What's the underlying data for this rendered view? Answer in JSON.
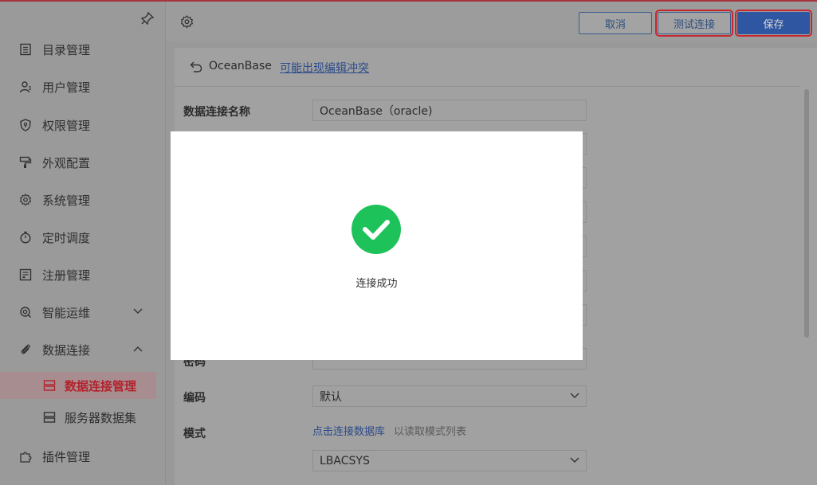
{
  "sidebar": {
    "items": [
      {
        "label": "目录管理",
        "icon": "list-icon"
      },
      {
        "label": "用户管理",
        "icon": "user-icon"
      },
      {
        "label": "权限管理",
        "icon": "shield-icon"
      },
      {
        "label": "外观配置",
        "icon": "paint-roller-icon"
      },
      {
        "label": "系统管理",
        "icon": "gear-icon"
      },
      {
        "label": "定时调度",
        "icon": "stopwatch-icon"
      },
      {
        "label": "注册管理",
        "icon": "register-icon"
      },
      {
        "label": "智能运维",
        "icon": "ops-icon"
      },
      {
        "label": "数据连接",
        "icon": "paperclip-icon"
      },
      {
        "label": "插件管理",
        "icon": "puzzle-icon"
      }
    ],
    "sub_items": [
      {
        "label": "数据连接管理",
        "icon": "server-icon",
        "active": true
      },
      {
        "label": "服务器数据集",
        "icon": "server-icon",
        "active": false
      }
    ]
  },
  "toolbar": {
    "cancel_label": "取消",
    "test_label": "测试连接",
    "save_label": "保存"
  },
  "header": {
    "connection_name": "OceanBase",
    "conflict_link": "可能出现编辑冲突"
  },
  "form": {
    "name_label": "数据连接名称",
    "name_value": "OceanBase（oracle)",
    "password_label": "密码",
    "password_value": "••••••••••••••",
    "encoding_label": "编码",
    "encoding_value": "默认",
    "mode_label": "模式",
    "mode_link": "点击连接数据库",
    "mode_hint": "以读取模式列表",
    "schema_value": "LBACSYS"
  },
  "modal": {
    "message": "连接成功",
    "icon": "check-circle-icon",
    "color": "#1ec25a"
  },
  "colors": {
    "accent": "#2f56a0",
    "active_red": "#b3222c"
  }
}
